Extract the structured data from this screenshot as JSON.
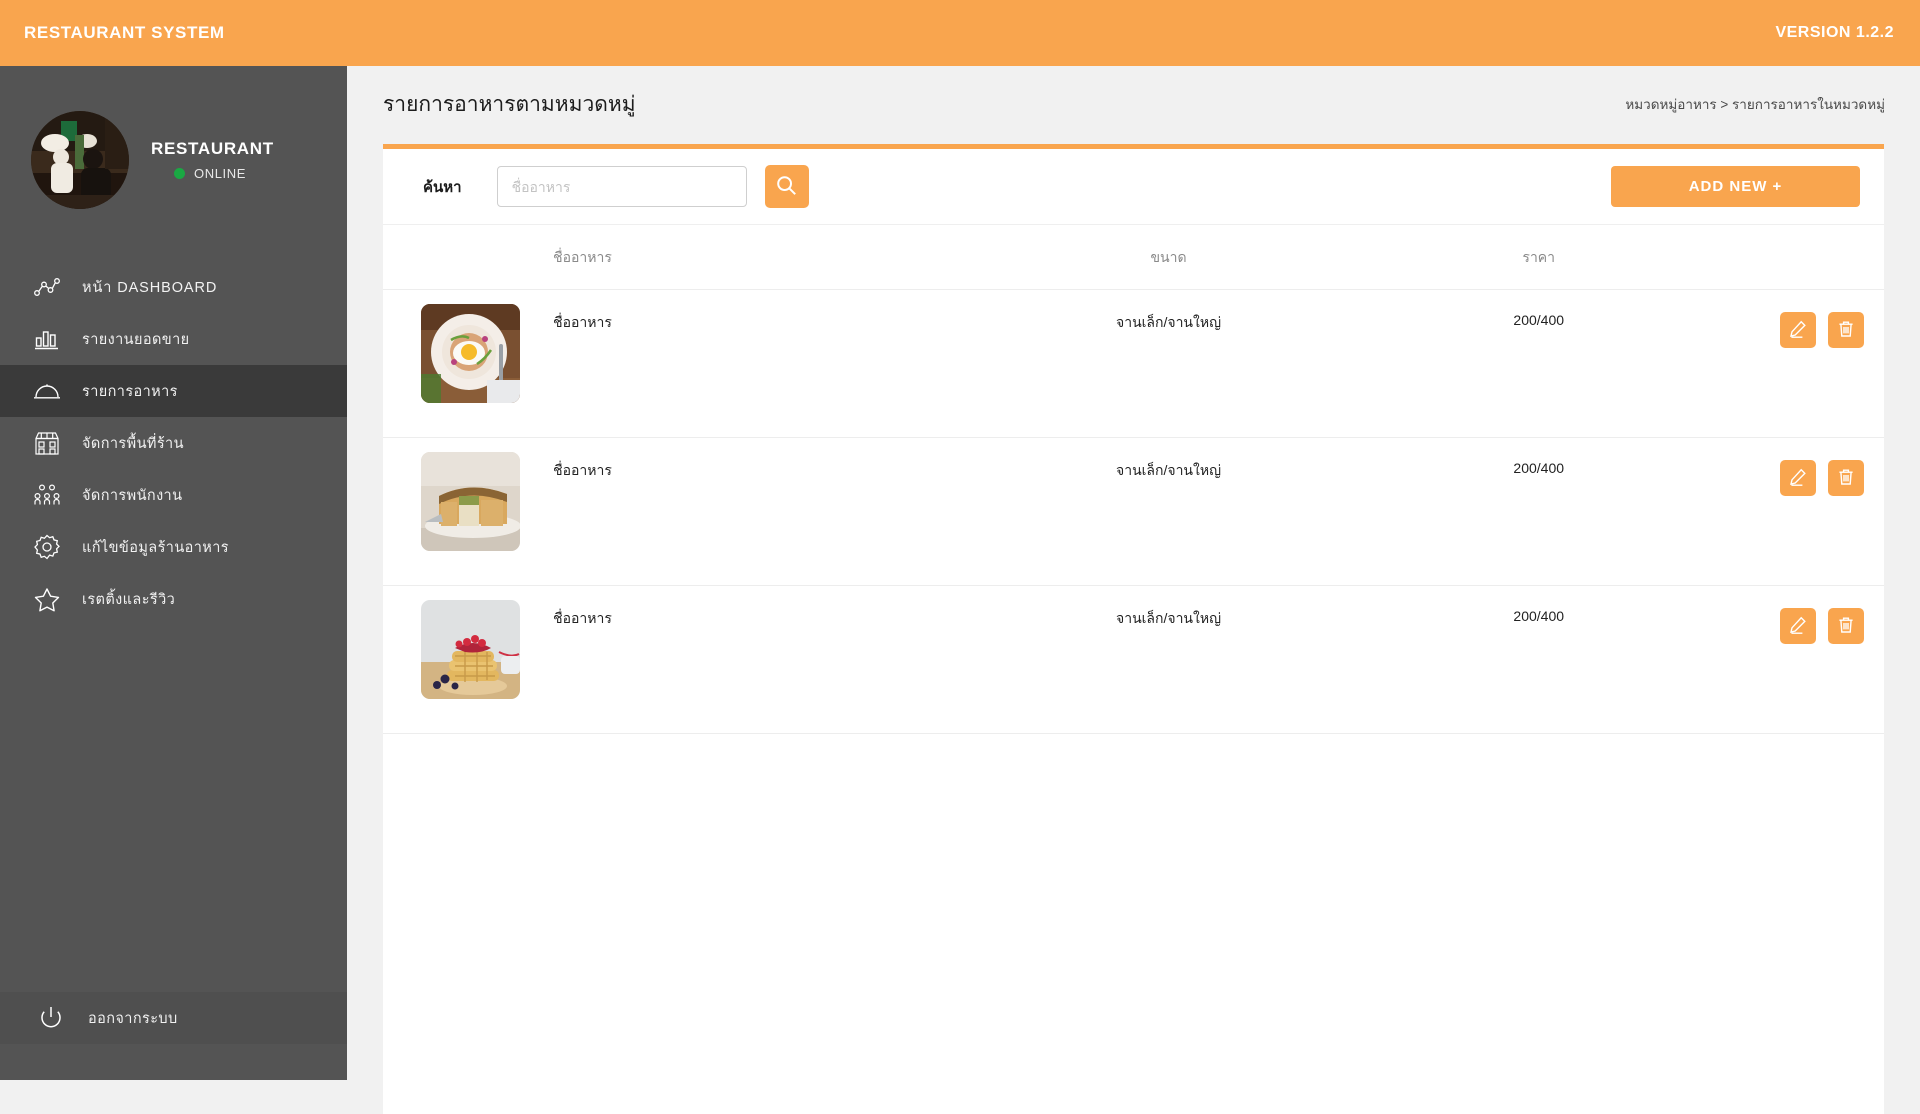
{
  "topbar": {
    "title": "RESTAURANT SYSTEM",
    "version": "VERSION 1.2.2"
  },
  "colors": {
    "accent": "#f9a54e",
    "sidebar": "#545454",
    "sidebar_active": "#3a3a3a",
    "online": "#1aa843",
    "page_bg": "#f1f1f1"
  },
  "sidebar": {
    "profile": {
      "name": "RESTAURANT",
      "status": "ONLINE",
      "avatar_icon": "restaurant-photo"
    },
    "items": [
      {
        "label": "หน้า DASHBOARD",
        "icon": "network-nodes-icon",
        "active": false
      },
      {
        "label": "รายงานยอดขาย",
        "icon": "bar-chart-icon",
        "active": false
      },
      {
        "label": "รายการอาหาร",
        "icon": "food-cloche-icon",
        "active": true
      },
      {
        "label": "จัดการพื้นที่ร้าน",
        "icon": "storefront-icon",
        "active": false
      },
      {
        "label": "จัดการพนักงาน",
        "icon": "people-group-icon",
        "active": false
      },
      {
        "label": "แก้ไขข้อมูลร้านอาหาร",
        "icon": "gear-icon",
        "active": false
      },
      {
        "label": "เรตติ้งและรีวิว",
        "icon": "star-icon",
        "active": false
      }
    ],
    "logout": {
      "label": "ออกจากระบบ",
      "icon": "power-icon"
    }
  },
  "page": {
    "title": "รายการอาหารตามหมวดหมู่",
    "breadcrumb": "หมวดหมู่อาหาร > รายการอาหารในหมวดหมู่"
  },
  "toolbar": {
    "search_label": "ค้นหา",
    "search_value": "",
    "search_placeholder": "ชื่ออาหาร",
    "search_icon": "search-icon",
    "add_label": "ADD NEW +"
  },
  "table": {
    "headers": {
      "image": "",
      "name": "ชื่ออาหาร",
      "size": "ขนาด",
      "price": "ราคา",
      "actions": ""
    },
    "rows": [
      {
        "image": "fried-egg-plate-photo",
        "name": "ชื่ออาหาร",
        "size": "จานเล็ก/จานใหญ่",
        "price": "200/400",
        "edit_icon": "pencil-icon",
        "delete_icon": "trash-icon"
      },
      {
        "image": "quiche-pie-photo",
        "name": "ชื่ออาหาร",
        "size": "จานเล็ก/จานใหญ่",
        "price": "200/400",
        "edit_icon": "pencil-icon",
        "delete_icon": "trash-icon"
      },
      {
        "image": "waffle-berries-photo",
        "name": "ชื่ออาหาร",
        "size": "จานเล็ก/จานใหญ่",
        "price": "200/400",
        "edit_icon": "pencil-icon",
        "delete_icon": "trash-icon"
      }
    ]
  }
}
